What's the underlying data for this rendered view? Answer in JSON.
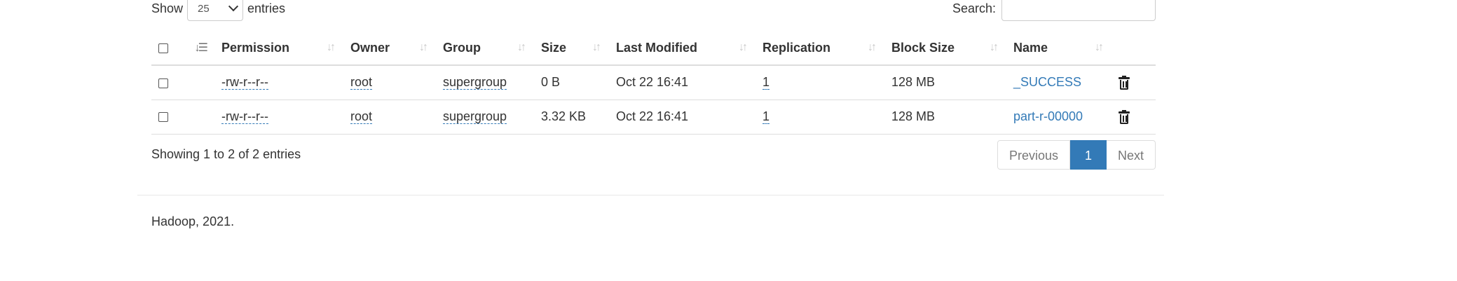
{
  "length_menu": {
    "prefix": "Show",
    "value": "25",
    "suffix": "entries"
  },
  "search": {
    "label": "Search:",
    "value": ""
  },
  "table": {
    "columns": [
      "Permission",
      "Owner",
      "Group",
      "Size",
      "Last Modified",
      "Replication",
      "Block Size",
      "Name"
    ],
    "rows": [
      {
        "permission": "-rw-r--r--",
        "owner": "root",
        "group": "supergroup",
        "size": "0 B",
        "modified": "Oct 22 16:41",
        "replication": "1",
        "block_size": "128 MB",
        "name": "_SUCCESS"
      },
      {
        "permission": "-rw-r--r--",
        "owner": "root",
        "group": "supergroup",
        "size": "3.32 KB",
        "modified": "Oct 22 16:41",
        "replication": "1",
        "block_size": "128 MB",
        "name": "part-r-00000"
      }
    ]
  },
  "info": "Showing 1 to 2 of 2 entries",
  "pagination": {
    "previous": "Previous",
    "current": "1",
    "next": "Next"
  },
  "footer": "Hadoop, 2021.",
  "colors": {
    "link": "#337ab7",
    "border": "#dddddd",
    "text": "#333333"
  }
}
